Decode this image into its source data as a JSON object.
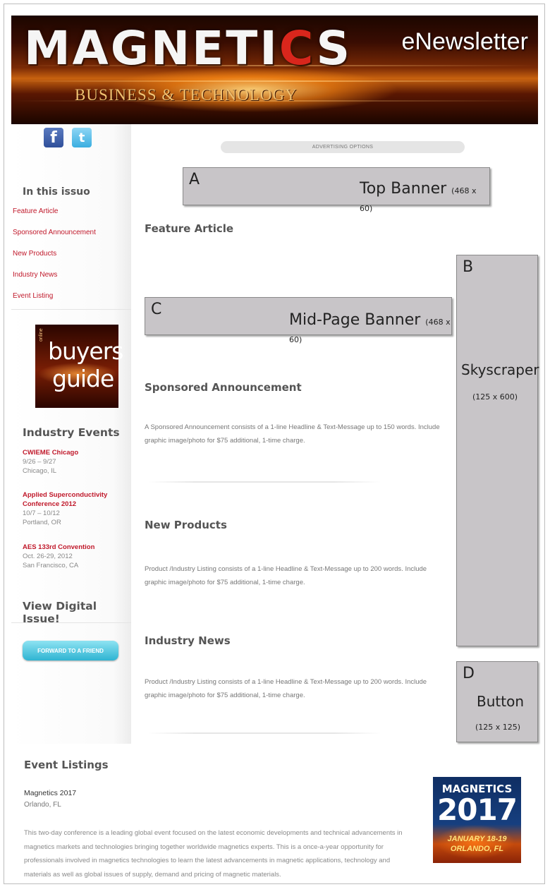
{
  "header": {
    "logo_before": "MAGNETI",
    "logo_red": "C",
    "logo_after": "S",
    "logo_subtitle": "BUSINESS & TECHNOLOGY",
    "newsletter_label": "eNewsletter"
  },
  "sidebar": {
    "social": [
      {
        "icon": "facebook-icon",
        "glyph": "f"
      },
      {
        "icon": "twitter-icon",
        "glyph": "t"
      }
    ],
    "in_this_issue_heading": "In this issuo",
    "toc": [
      "Feature Article",
      "Sponsored Announcement",
      "New Products",
      "Industry News",
      "Event Listing"
    ],
    "buyers_guide": {
      "line1": "buyers",
      "line2": "guide",
      "tag": "online"
    },
    "industry_events_heading": "Industry Events",
    "events": [
      {
        "name": "CWIEME Chicago",
        "date": "9/26 – 9/27",
        "location": "Chicago, IL"
      },
      {
        "name": "Applied Superconductivity Conference 2012",
        "date": "10/7 – 10/12",
        "location": "Portland, OR"
      },
      {
        "name": "AES 133rd Convention",
        "date": "Oct. 26-29, 2012",
        "location": "San Francisco, CA"
      }
    ],
    "view_digital": "View Digital Issue!",
    "forward_button": "FORWARD TO A FRIEND"
  },
  "main": {
    "advertising_options": "ADVERTISING OPTIONS",
    "ads": {
      "top": {
        "letter": "A",
        "name": "Top Banner",
        "size": "(468 x 60)"
      },
      "skyscraper": {
        "letter": "B",
        "name": "Skyscraper",
        "size": "(125 x 600)"
      },
      "mid": {
        "letter": "C",
        "name": "Mid-Page Banner",
        "size": "(468 x 60)"
      },
      "button": {
        "letter": "D",
        "name": "Button",
        "size": "(125 x 125)"
      }
    },
    "sections": {
      "feature": "Feature Article",
      "sponsored": "Sponsored Announcement",
      "sponsored_text": "A Sponsored Announcement consists of a 1-line Headline & Text-Message up to 150 words. Include graphic image/photo for $75 additional, 1-time charge.",
      "new_products": "New Products",
      "new_products_text": "Product /Industry Listing consists of a 1-line Headline & Text-Message up to 200 words. Include graphic image/photo for $75 additional, 1-time charge.",
      "industry_news": "Industry News",
      "industry_news_text": "Product /Industry Listing consists of a 1-line Headline & Text-Message up to 200 words. Include graphic image/photo for $75 additional, 1-time charge."
    }
  },
  "event_listings": {
    "heading": "Event Listings",
    "event_name": "Magnetics 2017",
    "event_location": "Orlando, FL",
    "description": "This two-day conference is a leading global event focused on the latest economic developments and technical advancements in magnetics markets and technologies bringing together worldwide magnetics experts. This is a once-a-year opportunity for professionals involved in magnetics technologies to learn the latest advancements in magnetic applications, technology and materials as well as global issues of supply, demand and pricing of magnetic materials.",
    "badge": {
      "line1": "MAGNETICS",
      "line2": "2017",
      "line3": "JANUARY 18-19",
      "line4": "ORLANDO, FL"
    }
  }
}
